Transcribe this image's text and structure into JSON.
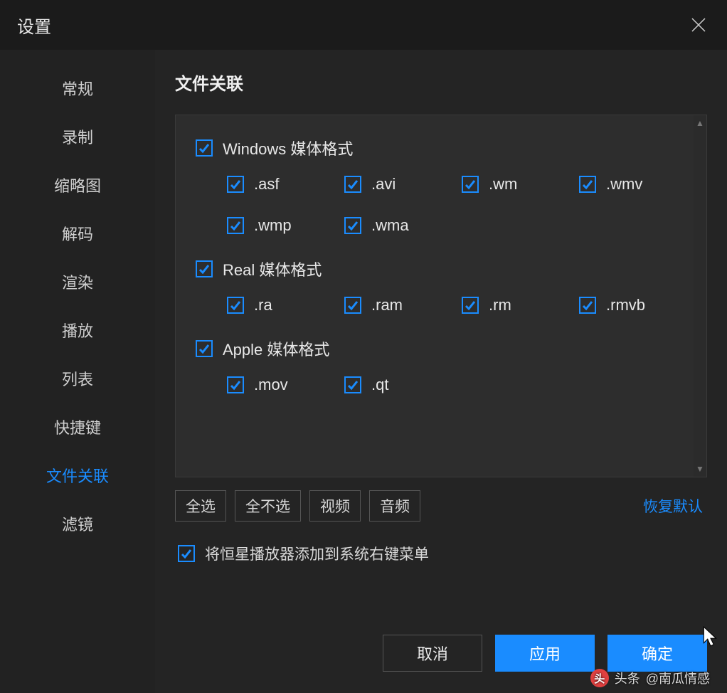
{
  "title": "设置",
  "sidebar": {
    "items": [
      {
        "label": "常规"
      },
      {
        "label": "录制"
      },
      {
        "label": "缩略图"
      },
      {
        "label": "解码"
      },
      {
        "label": "渲染"
      },
      {
        "label": "播放"
      },
      {
        "label": "列表"
      },
      {
        "label": "快捷键"
      },
      {
        "label": "文件关联"
      },
      {
        "label": "滤镜"
      }
    ],
    "active_index": 8
  },
  "section_title": "文件关联",
  "groups": [
    {
      "label": "Windows 媒体格式",
      "checked": true,
      "exts": [
        {
          "label": ".asf",
          "checked": true
        },
        {
          "label": ".avi",
          "checked": true
        },
        {
          "label": ".wm",
          "checked": true
        },
        {
          "label": ".wmv",
          "checked": true
        },
        {
          "label": ".wmp",
          "checked": true
        },
        {
          "label": ".wma",
          "checked": true
        }
      ]
    },
    {
      "label": "Real 媒体格式",
      "checked": true,
      "exts": [
        {
          "label": ".ra",
          "checked": true
        },
        {
          "label": ".ram",
          "checked": true
        },
        {
          "label": ".rm",
          "checked": true
        },
        {
          "label": ".rmvb",
          "checked": true
        }
      ]
    },
    {
      "label": "Apple 媒体格式",
      "checked": true,
      "exts": [
        {
          "label": ".mov",
          "checked": true
        },
        {
          "label": ".qt",
          "checked": true
        }
      ]
    }
  ],
  "quick": {
    "select_all": "全选",
    "select_none": "全不选",
    "video": "视频",
    "audio": "音频",
    "restore": "恢复默认"
  },
  "context_menu": {
    "checked": true,
    "label": "将恒星播放器添加到系统右键菜单"
  },
  "footer": {
    "cancel": "取消",
    "apply": "应用",
    "ok": "确定"
  },
  "watermark": {
    "brand": "头条",
    "author": "@南瓜情感",
    "logo": "头"
  }
}
